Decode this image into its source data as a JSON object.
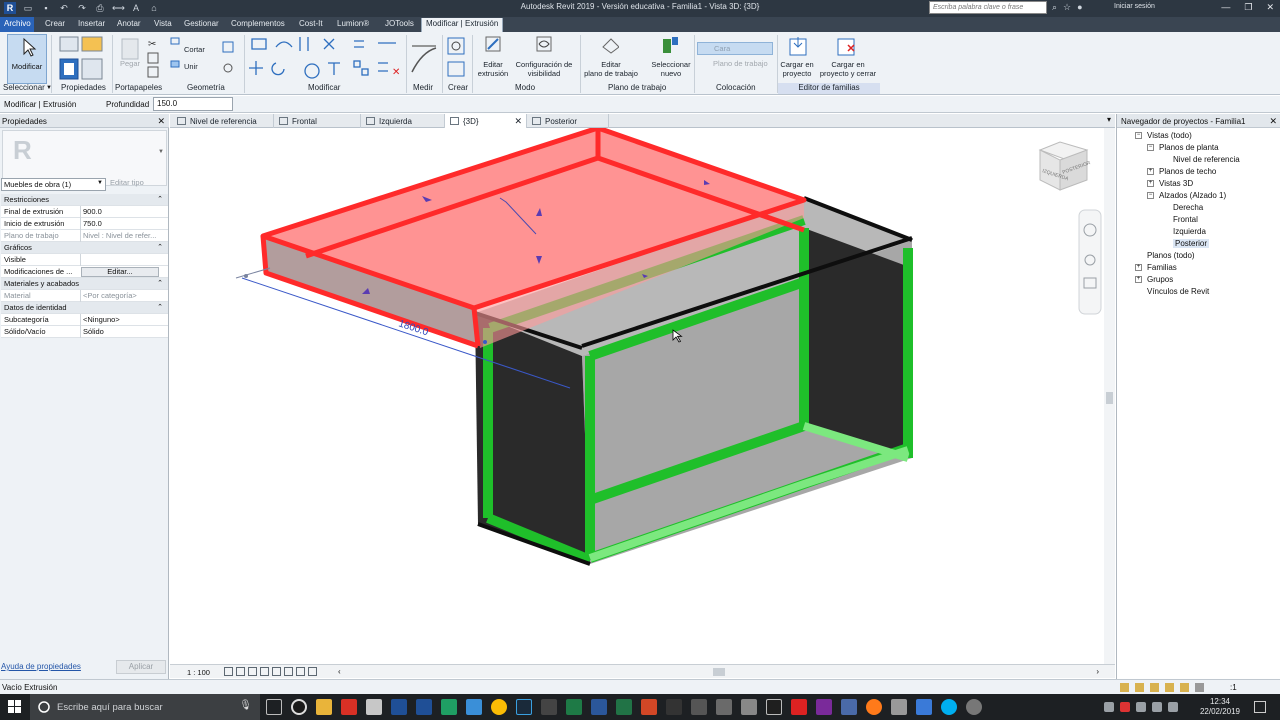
{
  "window": {
    "title": "Autodesk Revit 2019 - Versión educativa - Familia1 - Vista 3D: {3D}",
    "search_placeholder": "Escriba palabra clave o frase",
    "sign_in": "Iniciar sesión"
  },
  "menu": {
    "file": "Archivo",
    "tabs": [
      "Crear",
      "Insertar",
      "Anotar",
      "Vista",
      "Gestionar",
      "Complementos",
      "Cost-It",
      "Lumion®",
      "JOTools"
    ],
    "active_tab": "Modificar | Extrusión"
  },
  "ribbon": {
    "modify_button": "Modificar",
    "cut_label": "Cortar",
    "join_label": "Unir",
    "paste_label": "Pegar",
    "panels": [
      "Seleccionar",
      "Propiedades",
      "Portapapeles",
      "Geometría",
      "Modificar",
      "Medir",
      "Crear",
      "Modo",
      "Plano de trabajo",
      "Colocación",
      "Editor de familias"
    ],
    "edit_extrusion": [
      "Editar",
      "extrusión"
    ],
    "visibility_settings": [
      "Configuración de",
      "visibilidad"
    ],
    "edit_work_plane": [
      "Editar",
      "plano de trabajo"
    ],
    "select_new": [
      "Seleccionar",
      "nuevo"
    ],
    "face_label": "Cara",
    "work_plane_label": "Plano de trabajo",
    "load_in_project": [
      "Cargar en",
      "proyecto"
    ],
    "load_close": [
      "Cargar en",
      "proyecto y cerrar"
    ]
  },
  "options_bar": {
    "context": "Modificar | Extrusión",
    "depth_label": "Profundidad",
    "depth_value": "150.0"
  },
  "properties": {
    "header": "Propiedades",
    "type_selector": "Muebles de obra (1)",
    "edit_type": "Editar tipo",
    "rows": [
      {
        "kind": "section",
        "k": "Restricciones"
      },
      {
        "kind": "row",
        "k": "Final de extrusión",
        "v": "900.0"
      },
      {
        "kind": "row",
        "k": "Inicio de extrusión",
        "v": "750.0"
      },
      {
        "kind": "dim",
        "k": "Plano de trabajo",
        "v": "Nivel : Nivel de refer..."
      },
      {
        "kind": "section",
        "k": "Gráficos"
      },
      {
        "kind": "check",
        "k": "Visible",
        "v": "✓"
      },
      {
        "kind": "button",
        "k": "Modificaciones de ...",
        "v": "Editar..."
      },
      {
        "kind": "section",
        "k": "Materiales y acabados"
      },
      {
        "kind": "dim",
        "k": "Material",
        "v": "<Por categoría>"
      },
      {
        "kind": "section",
        "k": "Datos de identidad"
      },
      {
        "kind": "row",
        "k": "Subcategoría",
        "v": "<Ninguno>"
      },
      {
        "kind": "row",
        "k": "Sólido/Vacío",
        "v": "Sólido"
      }
    ],
    "help_link": "Ayuda de propiedades",
    "apply": "Aplicar"
  },
  "view_tabs": [
    {
      "label": "Nivel de referencia",
      "active": false
    },
    {
      "label": "Frontal",
      "active": false
    },
    {
      "label": "Izquierda",
      "active": false
    },
    {
      "label": "{3D}",
      "active": true
    },
    {
      "label": "Posterior",
      "active": false
    }
  ],
  "viewport": {
    "dimension_label": "1800.0",
    "viewcube_faces": [
      "IZQUIERDA",
      "POSTERIOR"
    ],
    "scale": "1 : 100"
  },
  "browser": {
    "header": "Navegador de proyectos - Familia1",
    "nodes": [
      {
        "label": "Vistas (todo)",
        "level": 0,
        "toggle": "−"
      },
      {
        "label": "Planos de planta",
        "level": 1,
        "toggle": "−"
      },
      {
        "label": "Nivel de referencia",
        "level": 2,
        "toggle": ""
      },
      {
        "label": "Planos de techo",
        "level": 1,
        "toggle": "+"
      },
      {
        "label": "Vistas 3D",
        "level": 1,
        "toggle": "+"
      },
      {
        "label": "Alzados (Alzado 1)",
        "level": 1,
        "toggle": "−"
      },
      {
        "label": "Derecha",
        "level": 2,
        "toggle": ""
      },
      {
        "label": "Frontal",
        "level": 2,
        "toggle": ""
      },
      {
        "label": "Izquierda",
        "level": 2,
        "toggle": ""
      },
      {
        "label": "Posterior",
        "level": 2,
        "toggle": "",
        "selected": true
      },
      {
        "label": "Planos (todo)",
        "level": 0,
        "toggle": ""
      },
      {
        "label": "Familias",
        "level": 0,
        "toggle": "+"
      },
      {
        "label": "Grupos",
        "level": 0,
        "toggle": "+"
      },
      {
        "label": "Vínculos de Revit",
        "level": 0,
        "toggle": ""
      }
    ]
  },
  "status": {
    "text": "Vacío Extrusión",
    "selection_count": ":1"
  },
  "taskbar": {
    "search_text": "Escribe aquí para buscar",
    "time": "12:34",
    "date": "22/02/2019"
  },
  "colors": {
    "solid_red": "#ff3a3a",
    "void_green": "#22c232",
    "accent_blue": "#2a63b8"
  }
}
